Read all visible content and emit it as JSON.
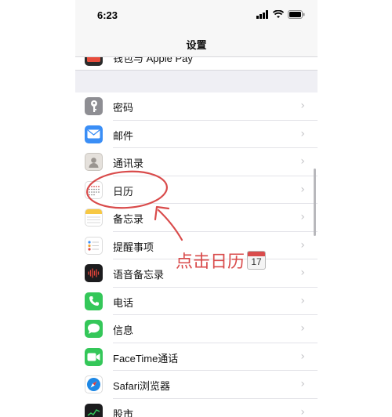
{
  "status_bar": {
    "time": "6:23"
  },
  "nav": {
    "title": "设置"
  },
  "rows": [
    {
      "label": "钱包与 Apple Pay",
      "icon": "wallet-icon"
    },
    {
      "label": "密码",
      "icon": "key-icon"
    },
    {
      "label": "邮件",
      "icon": "mail-icon"
    },
    {
      "label": "通讯录",
      "icon": "contacts-icon"
    },
    {
      "label": "日历",
      "icon": "calendar-icon"
    },
    {
      "label": "备忘录",
      "icon": "notes-icon"
    },
    {
      "label": "提醒事项",
      "icon": "reminders-icon"
    },
    {
      "label": "语音备忘录",
      "icon": "voice-memos-icon"
    },
    {
      "label": "电话",
      "icon": "phone-icon"
    },
    {
      "label": "信息",
      "icon": "messages-icon"
    },
    {
      "label": "FaceTime通话",
      "icon": "facetime-icon"
    },
    {
      "label": "Safari浏览器",
      "icon": "safari-icon"
    },
    {
      "label": "股市",
      "icon": "stocks-icon"
    }
  ],
  "annotation": {
    "text": "点击日历",
    "emoji_day": "17"
  },
  "colors": {
    "annotation_red": "#d94b4b",
    "chevron": "#c4c4c7"
  }
}
